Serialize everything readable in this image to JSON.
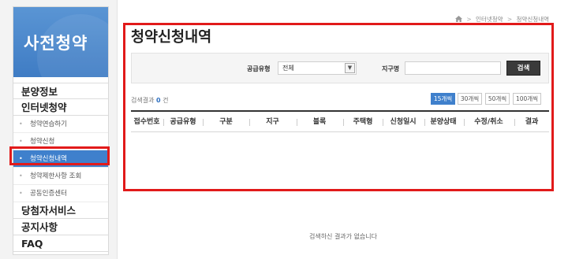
{
  "sidebar": {
    "title": "사전청약",
    "menu": [
      {
        "label": "분양정보"
      },
      {
        "label": "인터넷청약"
      }
    ],
    "submenu": [
      {
        "label": "청약연습하기",
        "active": false
      },
      {
        "label": "청약신청",
        "active": false
      },
      {
        "label": "청약신청내역",
        "active": true
      },
      {
        "label": "청약제한사항 조회",
        "active": false
      },
      {
        "label": "공동인증센터",
        "active": false
      }
    ],
    "menu_bottom": [
      {
        "label": "당첨자서비스"
      },
      {
        "label": "공지사항"
      },
      {
        "label": "FAQ"
      }
    ],
    "bullet": "•"
  },
  "breadcrumb": {
    "items": [
      "인터넷청약",
      "청약신청내역"
    ],
    "separator": ">"
  },
  "page_title": "청약신청내역",
  "search": {
    "supply_type_label": "공급유형",
    "supply_type_value": "전체",
    "district_label": "지구명",
    "district_value": "",
    "search_button": "검색"
  },
  "results": {
    "label": "검색결과",
    "count": "0",
    "unit": "건",
    "page_sizes": [
      "15개씩",
      "30개씩",
      "50개씩",
      "100개씩"
    ],
    "selected_page_size": "15개씩"
  },
  "table": {
    "columns": [
      "접수번호",
      "공급유형",
      "구분",
      "지구",
      "블록",
      "주택형",
      "신청일시",
      "분양상태",
      "수정/취소",
      "결과"
    ]
  },
  "empty_message": "검색하신 결과가 없습니다",
  "colors": {
    "sidebar_header": "#4a86cc",
    "active_menu": "#3f80cc",
    "highlight": "#e11a1a",
    "search_button": "#3a3a3a"
  }
}
